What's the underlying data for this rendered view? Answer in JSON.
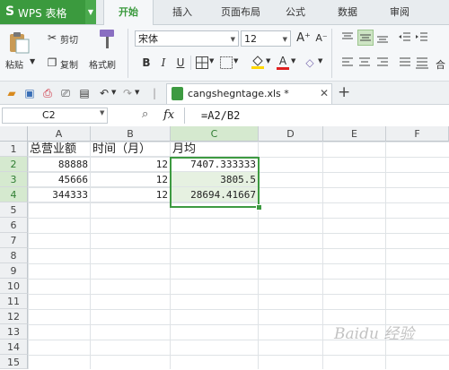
{
  "app": {
    "name": "WPS 表格",
    "logo": "S"
  },
  "menu_tabs": [
    "开始",
    "插入",
    "页面布局",
    "公式",
    "数据",
    "审阅"
  ],
  "ribbon": {
    "paste_label": "粘贴",
    "cut_label": "剪切",
    "copy_label": "复制",
    "format_painter_label": "格式刷",
    "font_name": "宋体",
    "font_size": "12",
    "grow_font": "A⁺",
    "shrink_font": "A⁻",
    "bold": "B",
    "italic": "I",
    "underline": "U",
    "font_color_glyph": "A",
    "font_color": "#e02020",
    "fill_color": "#ffd700",
    "right_edge_char": "合"
  },
  "document": {
    "tab_title": "cangshegntage.xls *"
  },
  "formula_bar": {
    "cell_ref": "C2",
    "fx": "fx",
    "formula": "=A2/B2"
  },
  "sheet": {
    "columns": [
      "A",
      "B",
      "C",
      "D",
      "E",
      "F"
    ],
    "rows": [
      "1",
      "2",
      "3",
      "4",
      "5",
      "6",
      "7",
      "8",
      "9",
      "10",
      "11",
      "12",
      "13",
      "14",
      "15"
    ],
    "headers": {
      "a1": "总营业额",
      "b1": "时间（月）",
      "c1": "月均"
    },
    "data": [
      {
        "a": "88888",
        "b": "12",
        "c": "7407.333333"
      },
      {
        "a": "45666",
        "b": "12",
        "c": "3805.5"
      },
      {
        "a": "344333",
        "b": "12",
        "c": "28694.41667"
      }
    ]
  },
  "colors": {
    "accent": "#3b9a3e",
    "selection": "#3d9a41"
  },
  "watermark": "Baidu 经验"
}
